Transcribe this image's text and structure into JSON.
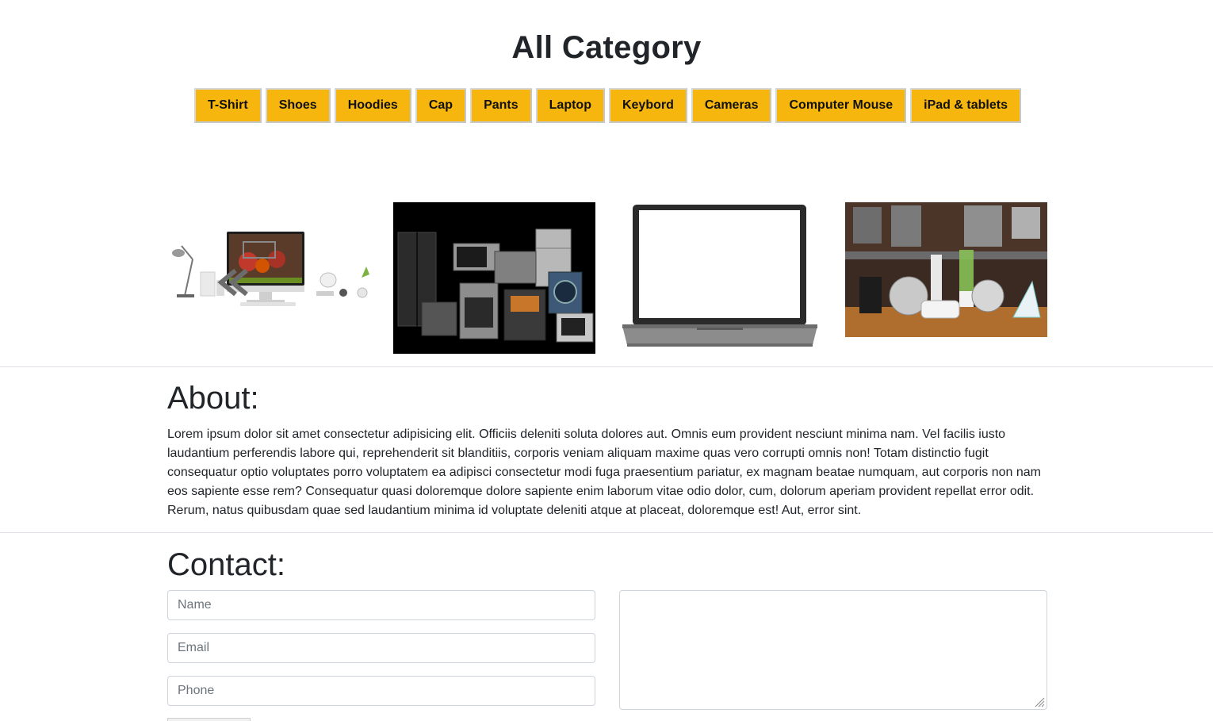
{
  "page": {
    "title": "All Category"
  },
  "categories": [
    {
      "label": "T-Shirt"
    },
    {
      "label": "Shoes"
    },
    {
      "label": "Hoodies"
    },
    {
      "label": "Cap"
    },
    {
      "label": "Pants"
    },
    {
      "label": "Laptop"
    },
    {
      "label": "Keybord"
    },
    {
      "label": "Cameras"
    },
    {
      "label": "Computer Mouse"
    },
    {
      "label": "iPad & tablets"
    }
  ],
  "gallery": {
    "images": [
      {
        "subject": "desktop-computer-workspace"
      },
      {
        "subject": "home-appliances-set"
      },
      {
        "subject": "laptop"
      },
      {
        "subject": "kitchen-appliances"
      }
    ],
    "prev_icon": "double-chevron-left-icon"
  },
  "about": {
    "heading": "About:",
    "body": "Lorem ipsum dolor sit amet consectetur adipisicing elit. Officiis deleniti soluta dolores aut. Omnis eum provident nesciunt minima nam. Vel facilis iusto laudantium perferendis labore qui, reprehenderit sit blanditiis, corporis veniam aliquam maxime quas vero corrupti omnis non! Totam distinctio fugit consequatur optio voluptates porro voluptatem ea adipisci consectetur modi fuga praesentium pariatur, ex magnam beatae numquam, aut corporis non nam eos sapiente esse rem? Consequatur quasi doloremque dolore sapiente enim laborum vitae odio dolor, cum, dolorum aperiam provident repellat error odit. Rerum, natus quibusdam quae sed laudantium minima id voluptate deleniti atque at placeat, doloremque est! Aut, error sint."
  },
  "contact": {
    "heading": "Contact:",
    "name_placeholder": "Name",
    "email_placeholder": "Email",
    "phone_placeholder": "Phone",
    "name_value": "",
    "email_value": "",
    "phone_value": "",
    "message_value": ""
  },
  "colors": {
    "button_bg": "#f6b60d",
    "text": "#212529",
    "border": "#ced4da"
  }
}
